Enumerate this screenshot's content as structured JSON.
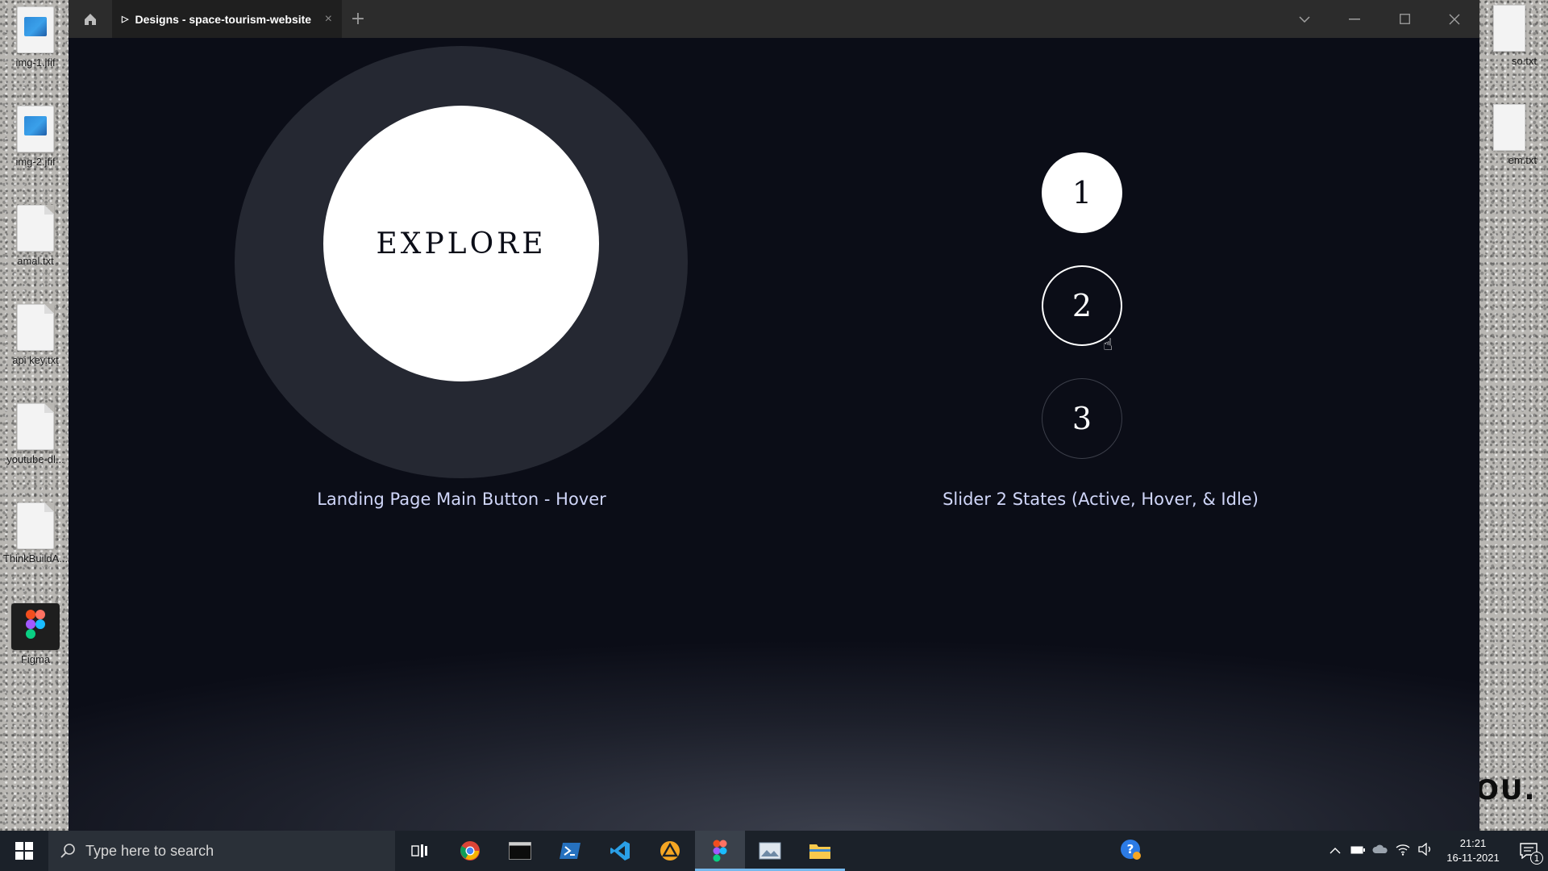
{
  "desktop": {
    "left_icons": [
      {
        "label": "img-1.jfif",
        "kind": "image"
      },
      {
        "label": "img-2.jfif",
        "kind": "image"
      },
      {
        "label": "amal.txt",
        "kind": "text"
      },
      {
        "label": "api key.txt",
        "kind": "text"
      },
      {
        "label": "youtube-dl...",
        "kind": "text"
      },
      {
        "label": "ThinkBuildA...",
        "kind": "text"
      },
      {
        "label": "Figma",
        "kind": "figma"
      }
    ],
    "right_icons": [
      {
        "label": "so.txt"
      },
      {
        "label": "em.txt"
      }
    ],
    "wallpaper_text": "OU."
  },
  "window": {
    "tab_title": "Designs - space-tourism-website",
    "canvas": {
      "explore_label": "EXPLORE",
      "explore_caption": "Landing Page Main Button - Hover",
      "slider_items": [
        "1",
        "2",
        "3"
      ],
      "slider_caption": "Slider 2 States (Active, Hover, & Idle)"
    }
  },
  "taskbar": {
    "search_placeholder": "Type here to search",
    "apps": [
      "task-view",
      "chrome",
      "terminal",
      "powershell",
      "vscode",
      "vlc",
      "figma",
      "photos",
      "file-explorer"
    ],
    "time": "21:21",
    "date": "16-11-2021",
    "notification_count": "1"
  },
  "colors": {
    "canvas_bg": "#0b0d17",
    "caption": "#d0d6f9",
    "outer_ring": "#252832",
    "titlebar": "#2c2c2c",
    "taskbar": "#1b2129"
  }
}
